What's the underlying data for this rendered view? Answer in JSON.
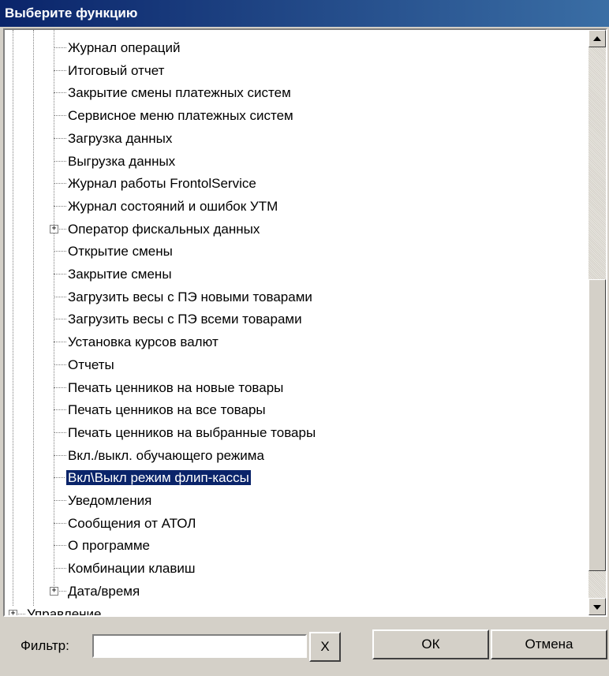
{
  "window": {
    "title": "Выберите функцию"
  },
  "tree": {
    "items": [
      {
        "label": "Журнал операций",
        "level": 3,
        "expandable": false,
        "selected": false
      },
      {
        "label": "Итоговый отчет",
        "level": 3,
        "expandable": false,
        "selected": false
      },
      {
        "label": "Закрытие смены платежных систем",
        "level": 3,
        "expandable": false,
        "selected": false
      },
      {
        "label": "Сервисное меню платежных систем",
        "level": 3,
        "expandable": false,
        "selected": false
      },
      {
        "label": "Загрузка данных",
        "level": 3,
        "expandable": false,
        "selected": false
      },
      {
        "label": "Выгрузка данных",
        "level": 3,
        "expandable": false,
        "selected": false
      },
      {
        "label": "Журнал работы FrontolService",
        "level": 3,
        "expandable": false,
        "selected": false
      },
      {
        "label": "Журнал состояний и ошибок УТМ",
        "level": 3,
        "expandable": false,
        "selected": false
      },
      {
        "label": "Оператор фискальных данных",
        "level": 3,
        "expandable": true,
        "selected": false
      },
      {
        "label": "Открытие смены",
        "level": 3,
        "expandable": false,
        "selected": false
      },
      {
        "label": "Закрытие смены",
        "level": 3,
        "expandable": false,
        "selected": false
      },
      {
        "label": "Загрузить весы с ПЭ новыми товарами",
        "level": 3,
        "expandable": false,
        "selected": false
      },
      {
        "label": "Загрузить весы с ПЭ всеми товарами",
        "level": 3,
        "expandable": false,
        "selected": false
      },
      {
        "label": "Установка курсов валют",
        "level": 3,
        "expandable": false,
        "selected": false
      },
      {
        "label": "Отчеты",
        "level": 3,
        "expandable": false,
        "selected": false
      },
      {
        "label": "Печать ценников на новые товары",
        "level": 3,
        "expandable": false,
        "selected": false
      },
      {
        "label": "Печать ценников на все товары",
        "level": 3,
        "expandable": false,
        "selected": false
      },
      {
        "label": "Печать ценников на выбранные товары",
        "level": 3,
        "expandable": false,
        "selected": false
      },
      {
        "label": "Вкл./выкл. обучающего режима",
        "level": 3,
        "expandable": false,
        "selected": false
      },
      {
        "label": "Вкл\\Выкл режим флип-кассы",
        "level": 3,
        "expandable": false,
        "selected": true
      },
      {
        "label": "Уведомления",
        "level": 3,
        "expandable": false,
        "selected": false
      },
      {
        "label": "Сообщения от АТОЛ",
        "level": 3,
        "expandable": false,
        "selected": false
      },
      {
        "label": "О программе",
        "level": 3,
        "expandable": false,
        "selected": false
      },
      {
        "label": "Комбинации клавиш",
        "level": 3,
        "expandable": false,
        "selected": false
      },
      {
        "label": "Дата/время",
        "level": 3,
        "expandable": true,
        "selected": false
      },
      {
        "label": "Управление",
        "level": 1,
        "expandable": true,
        "selected": false
      }
    ]
  },
  "filter": {
    "label": "Фильтр:",
    "value": "",
    "clear_label": "X"
  },
  "buttons": {
    "ok_label": "ОК",
    "cancel_label": "Отмена"
  },
  "colors": {
    "selection": "#0a246a",
    "titlebar": "#0a246a",
    "face": "#d4d0c8"
  }
}
